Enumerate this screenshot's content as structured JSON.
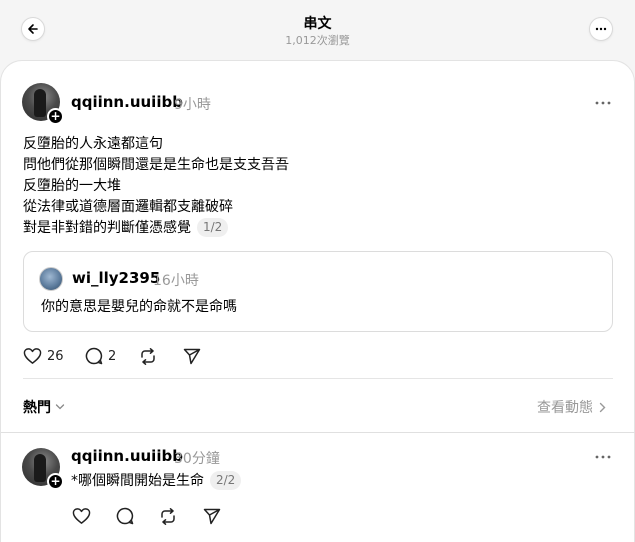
{
  "header": {
    "title": "串文",
    "views": "1,012次瀏覽"
  },
  "post": {
    "username": "qqiinn.uuiibb",
    "time": "9小時",
    "lines": [
      "反墮胎的人永遠都這句",
      "問他們從那個瞬間還是是生命也是支支吾吾",
      "反墮胎的一大堆",
      "從法律或道德層面邏輯都支離破碎",
      "對是非對錯的判斷僅憑感覺"
    ],
    "pager": "1/2",
    "quote": {
      "username": "wi_lly2395",
      "time": "16小時",
      "text": "你的意思是嬰兒的命就不是命嗎"
    },
    "likes": "26",
    "comments": "2"
  },
  "sort": {
    "label": "熱門",
    "activity_link": "查看動態"
  },
  "reply": {
    "username": "qqiinn.uuiibb",
    "time": "30分鐘",
    "text": "*哪個瞬間開始是生命",
    "pager": "2/2"
  }
}
